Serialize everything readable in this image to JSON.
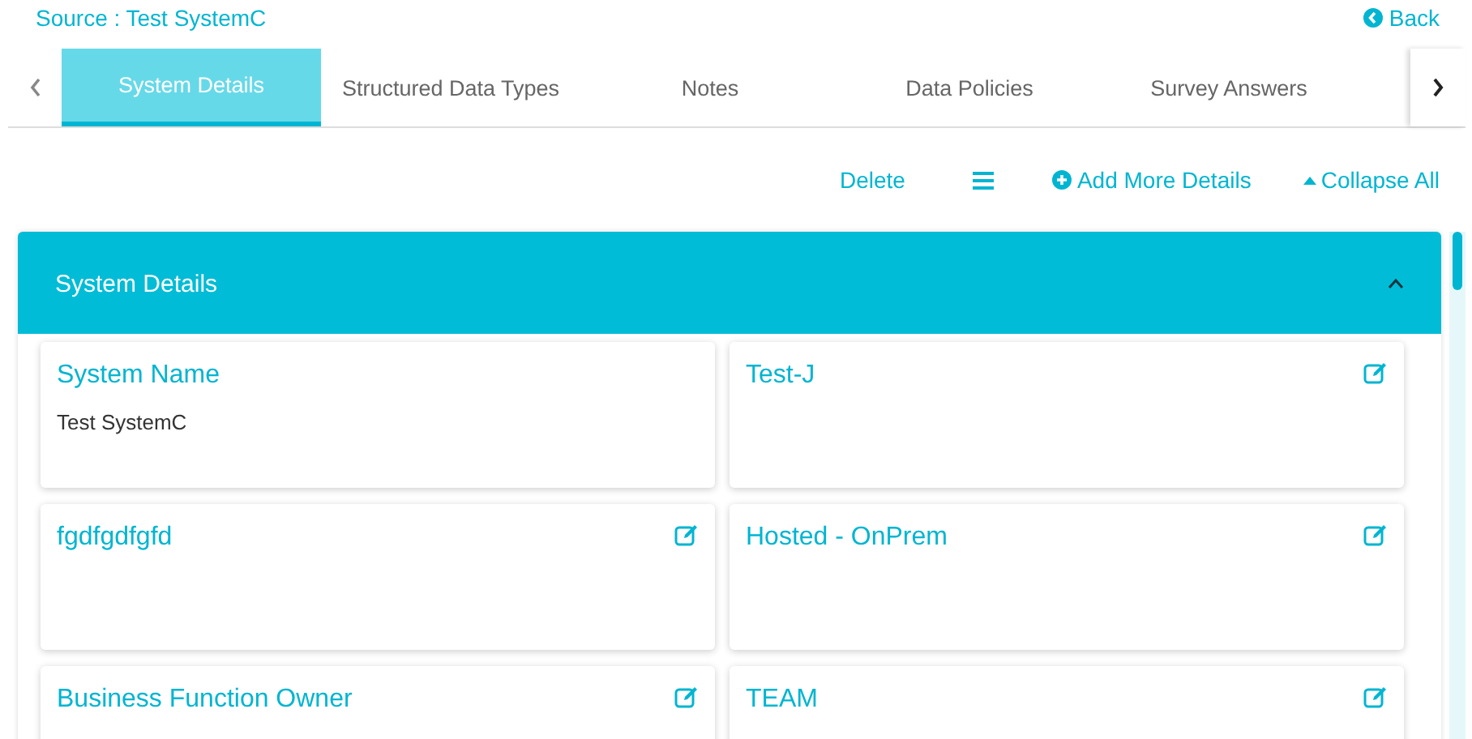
{
  "source_label": "Source : Test SystemC",
  "back_link": "Back",
  "tabs": [
    {
      "label": "System Details",
      "selected": true
    },
    {
      "label": "Structured Data Types",
      "selected": false
    },
    {
      "label": "Notes",
      "selected": false
    },
    {
      "label": "Data Policies",
      "selected": false
    },
    {
      "label": "Survey Answers",
      "selected": false
    }
  ],
  "actions": [
    {
      "kind": "text",
      "label": "Delete"
    },
    {
      "kind": "menu"
    },
    {
      "kind": "add",
      "label": "Add More Details"
    },
    {
      "kind": "collapse",
      "label": "Collapse All"
    }
  ],
  "section": {
    "title": "System Details",
    "expanded": true,
    "cards": [
      {
        "title": "System Name",
        "value": "Test SystemC",
        "editable": false
      },
      {
        "title": "Test-J",
        "editable": true
      },
      {
        "title": "fgdfgdfgfd",
        "editable": true
      },
      {
        "title": "Hosted - OnPrem",
        "editable": true
      },
      {
        "title": "Business Function Owner",
        "editable": true
      },
      {
        "title": "TEAM",
        "editable": true
      }
    ]
  }
}
